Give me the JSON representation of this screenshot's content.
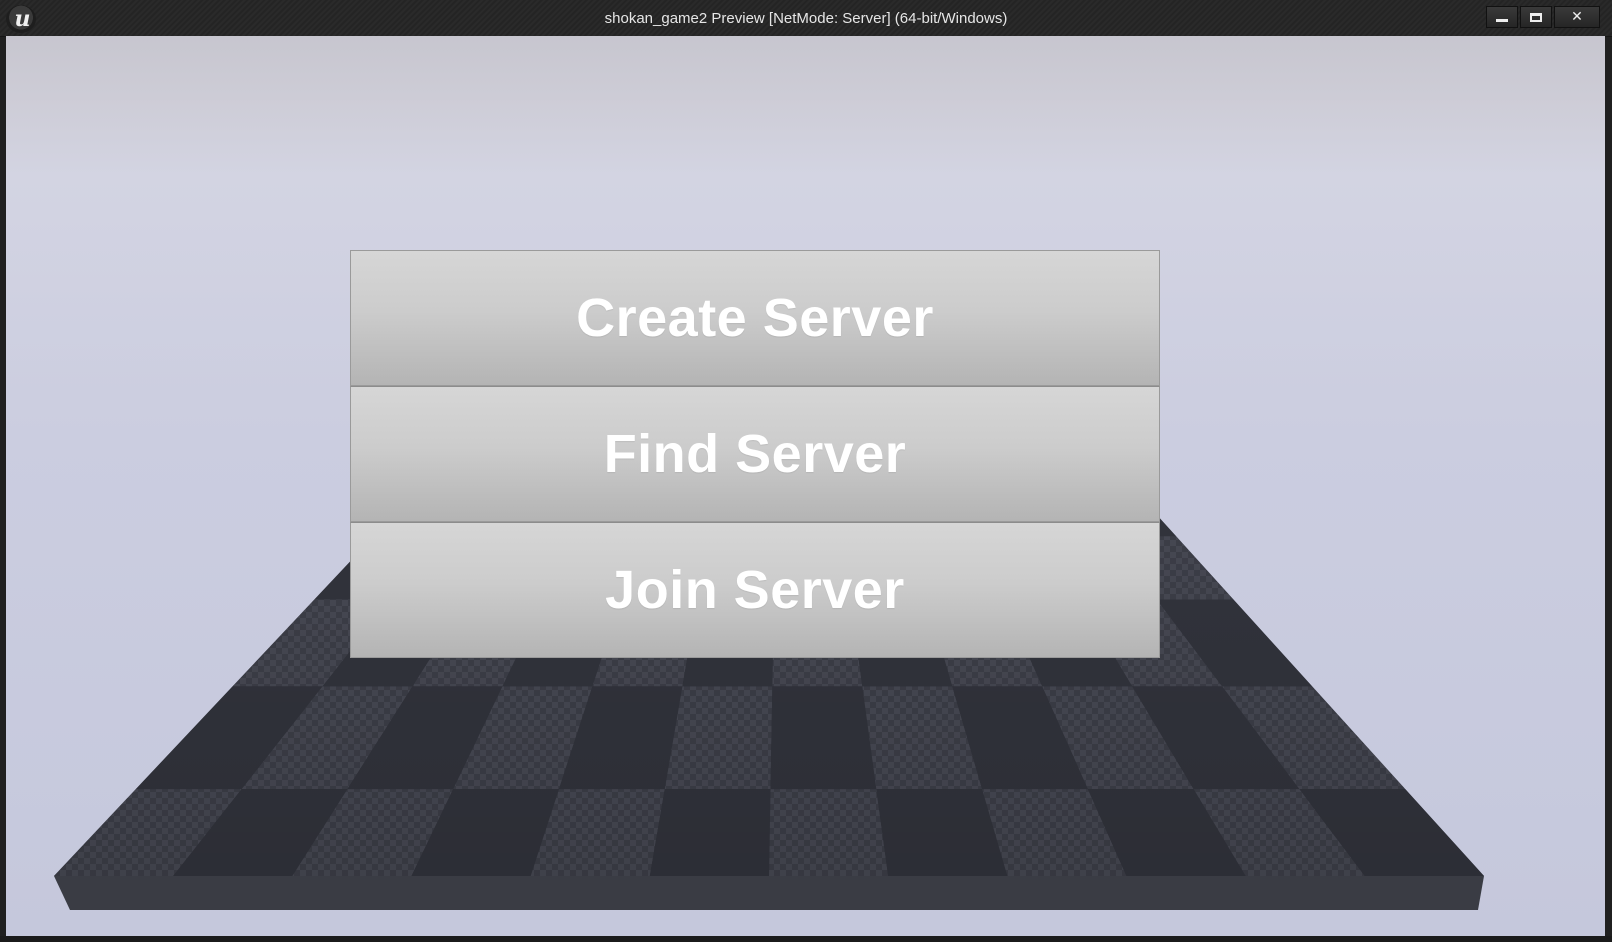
{
  "window": {
    "title": "shokan_game2 Preview [NetMode: Server] (64-bit/Windows)",
    "logo_icon": "unreal-engine-logo-icon",
    "controls": {
      "minimize_icon": "minimize-icon",
      "maximize_icon": "maximize-icon",
      "close_icon": "close-icon",
      "close_glyph": "✕"
    }
  },
  "menu": {
    "buttons": [
      {
        "label": "Create Server"
      },
      {
        "label": "Find Server"
      },
      {
        "label": "Join Server"
      }
    ]
  },
  "colors": {
    "button_top": "#d6d6d6",
    "button_bottom": "#b4b4b4",
    "button_text": "#ffffff",
    "sky": "#cbcde0",
    "floor_dark": "#34363f",
    "floor_light": "#43454f"
  }
}
